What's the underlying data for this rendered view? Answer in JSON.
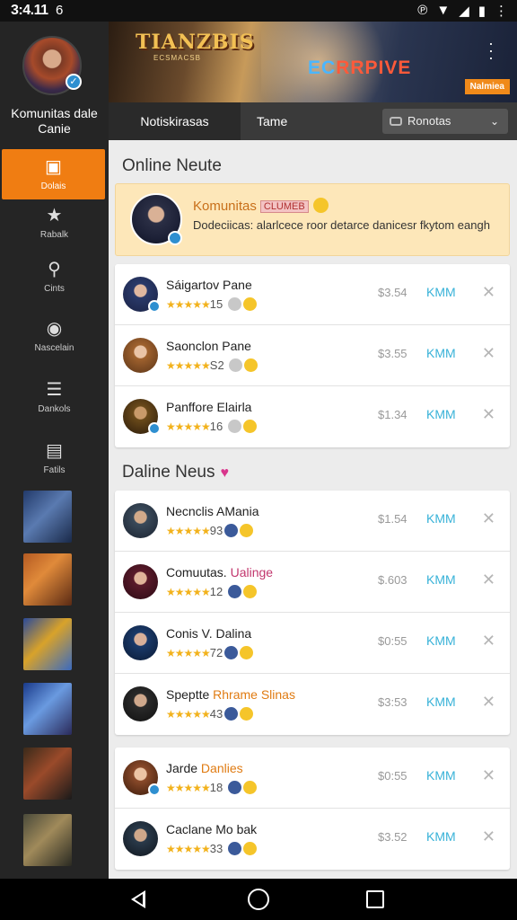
{
  "status": {
    "time": "3:4.11",
    "left_icon": "6"
  },
  "sidebar": {
    "profile_name": "Komunitas dale Canie",
    "items": [
      {
        "label": "Dolais",
        "icon": "controller-icon"
      },
      {
        "label": "Rabalk",
        "icon": "star-icon"
      },
      {
        "label": "Cints",
        "icon": "search-icon"
      },
      {
        "label": "Nascelain",
        "icon": "globe-icon"
      },
      {
        "label": "Dankols",
        "icon": "list-icon"
      },
      {
        "label": "Fatils",
        "icon": "camera-icon"
      }
    ]
  },
  "banner": {
    "logo": "TIANZBIS",
    "logo_sub": "ECSMACSB",
    "title": "EC",
    "title_rest": "RRPIVE",
    "tag": "Nalmiea"
  },
  "tabs": {
    "tab1": "Notiskirasas",
    "tab2": "Tame",
    "select_value": "Ronotas"
  },
  "section1": {
    "title": "Online Neute",
    "featured": {
      "title": "Komunitas",
      "pill": "CLUMEB",
      "desc": "Dodeciicas: alarlcece roor detarce danicesr fkytom eangh"
    },
    "rows": [
      {
        "name": "Sáigartov Pane",
        "accent": "",
        "rating": "15",
        "price": "$3.54",
        "action": "KMM"
      },
      {
        "name": "Saonclon Pane",
        "accent": "",
        "rating": "S2",
        "price": "$3.55",
        "action": "KMM"
      },
      {
        "name": "Panffore Elairla",
        "accent": "",
        "rating": "16",
        "price": "$1.34",
        "action": "KMM"
      }
    ]
  },
  "section2": {
    "title": "Daline Neus",
    "rows": [
      {
        "name": "Necnclis AMania",
        "accent": "",
        "rating": "93",
        "price": "$1.54",
        "action": "KMM"
      },
      {
        "name": "Comuutas. ",
        "accent": "Ualinge",
        "rating": "12",
        "price": "$.603",
        "action": "KMM"
      },
      {
        "name": "Conis V. Dalina",
        "accent": "",
        "rating": "72",
        "price": "$0:55",
        "action": "KMM"
      },
      {
        "name": "Speptte ",
        "accent": "Rhrame Slinas",
        "rating": "43",
        "price": "$3:53",
        "action": "KMM"
      }
    ]
  },
  "section3": {
    "rows": [
      {
        "name": "Jarde ",
        "accent": "Danlies",
        "rating": "18",
        "price": "$0:55",
        "action": "KMM"
      },
      {
        "name": "Caclane Mo bak",
        "accent": "",
        "rating": "33",
        "price": "$3.52",
        "action": "KMM"
      }
    ]
  }
}
